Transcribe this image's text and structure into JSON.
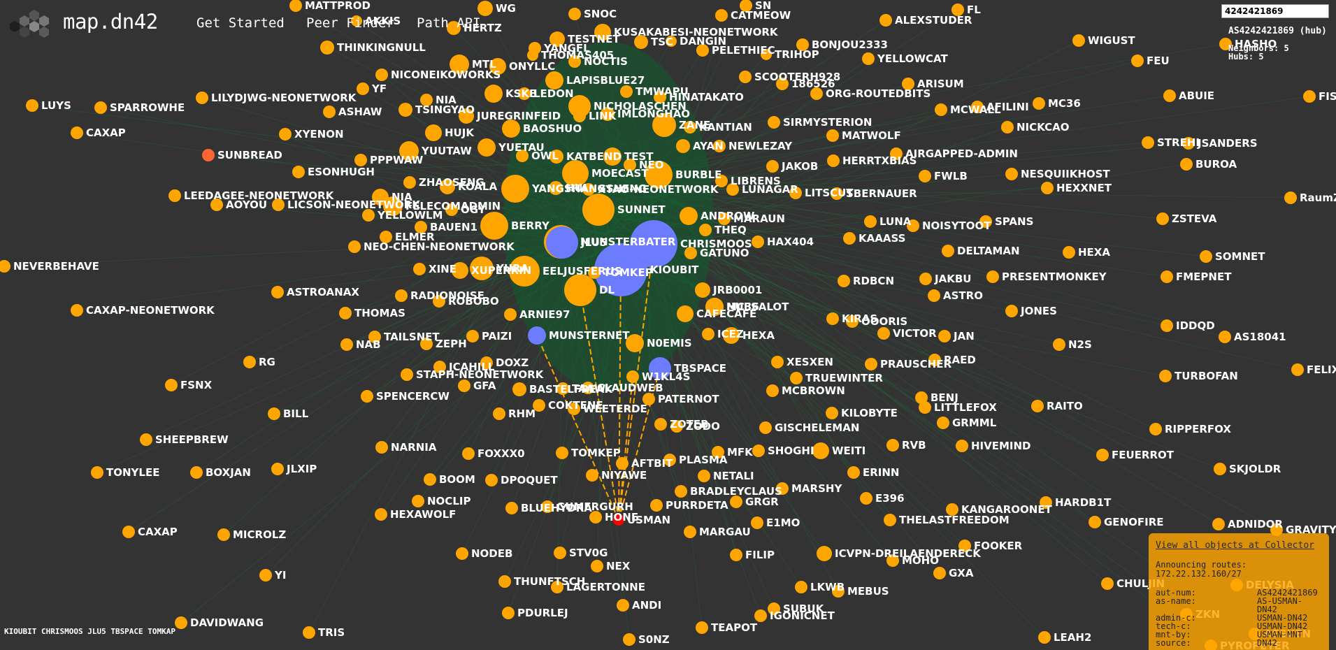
{
  "header": {
    "brand": "map.dn42",
    "nav": [
      "Get Started",
      "Peer Finder",
      "Path API"
    ]
  },
  "search": {
    "value": "4242421869"
  },
  "info": {
    "title": "AS4242421869 (hub)",
    "neighbors": "Neighbors: 5",
    "hubs": "Hubs: 5"
  },
  "collector": {
    "link": "View all objects at Collector",
    "routes_heading": "Announcing routes:",
    "route": "172.22.132.160/27",
    "fields": [
      [
        "aut-num:",
        "AS4242421869"
      ],
      [
        "as-name:",
        "AS-USMAN-DN42"
      ],
      [
        "admin-c:",
        "USMAN-DN42"
      ],
      [
        "tech-c:",
        "USMAN-DN42"
      ],
      [
        "mnt-by:",
        "USMAN-MNT"
      ],
      [
        "source:",
        "DN42"
      ]
    ]
  },
  "footer": {
    "hubs": "KIOUBIT CHRISMOOS JLU5 TBSPACE TOMKAP"
  },
  "colors": {
    "background": "#333333",
    "node": "#ffa500",
    "hub": "#6d7bff",
    "selected": "#ff0000",
    "sunbread": "#ff6432",
    "edge": "#1f7a3c",
    "highlight_edge": "#ffa500"
  },
  "graph": {
    "selected": "USMAN",
    "hubs": [
      "KIOUBIT",
      "CHRISMOOS",
      "JLU5",
      "TBSPACE",
      "MUNSTERNET"
    ],
    "nodes": [
      "MATTPROD",
      "WG",
      "AKKIS",
      "HERTZ",
      "SNOC",
      "SN",
      "CATMEOW",
      "ALEXSTUDER",
      "FL",
      "TESTNET",
      "KUSAKABESI-NEONETWORK",
      "YANGFL",
      "THOMAS405",
      "TSC",
      "DANGIN",
      "PELETHIEC",
      "TRIHOP",
      "BONJOU2333",
      "WIGUST",
      "HASHO",
      "THINKINGNULL",
      "MTL",
      "ONYLLC",
      "NOCTIS",
      "YELLOWCAT",
      "FEU",
      "NICONEIKOWORKS",
      "LAPISBLUE27",
      "SCOOTERH928",
      "186526",
      "ARISUM",
      "LUYS",
      "SPARROWHE",
      "LILYDJWG-NEONETWORK",
      "YF",
      "KSKB",
      "LEDON",
      "TMWAPU",
      "HINATAKATO",
      "ORG-ROUTEDBITS",
      "ABUIE",
      "FIS",
      "ASHAW",
      "NIA",
      "TSINGYAO",
      "JUREGRINFEID",
      "NICHOLASCHEN",
      "LINK",
      "IMLONGHAO",
      "MCWALL",
      "AFILINI",
      "MC36",
      "ZANE",
      "KANTIAN",
      "SIRMYSTERION",
      "NICKCAO",
      "XYENON",
      "HUJK",
      "BAOSHUO",
      "MATWOLF",
      "SUNBREAD",
      "YUUTAW",
      "YUETAU",
      "OWL",
      "KATBEND",
      "TEST",
      "NEO",
      "AYAN",
      "NEWLEZAY",
      "STREHI",
      "JSANDERS",
      "PPPWAW",
      "JAKOB",
      "HERRTXBIAS",
      "AIRGAPPED-ADMIN",
      "BUROA",
      "ESONHUGH",
      "MOECAST",
      "BURBLE",
      "FWLB",
      "NESQUIIKHOST",
      "ZHAOSENG",
      "KOALA",
      "YANGSHANGSHENG",
      "HUI",
      "XTAO-NEONETWORK",
      "LIBRENS",
      "LUNAGAR",
      "LITSCUT",
      "SBERNAUER",
      "HEXXNET",
      "LEEDAGEE-NEONETWORK",
      "AOYOU",
      "LICSON-NEONETWORK",
      "NIA",
      "FELECOMADMIN",
      "OGY",
      "RaumZ",
      "YELLOWLM",
      "SUNNET",
      "ANDROW",
      "MARAUN",
      "LUNA",
      "NOISYTOOT",
      "SPANS",
      "ZSTEVA",
      "BAUEN1",
      "BERRY",
      "THEQ",
      "KAAASS",
      "ELMER",
      "MUNSTERBATER",
      "JLU5",
      "HAX404",
      "DELTAMAN",
      "HEXA",
      "SOMNET",
      "NEO-CHEN-NEONETWORK",
      "CHRISMOOS",
      "GATUNO",
      "NEVERBEHAVE",
      "XINE",
      "XUPERRIN",
      "EELJUSFERUS",
      "KIOUBIT",
      "FMEPNET",
      "PRESENTMONKEY",
      "JAKBU",
      "RDBCN",
      "YURA",
      "JRB0001",
      "ASTROANAX",
      "RADIONOISE",
      "MC36",
      "DL",
      "ASTRO",
      "ROBOBO",
      "HUESALOT",
      "JONES",
      "CAXAP-NEONETWORK",
      "THOMAS",
      "ARNIE97",
      "CAFECAFE",
      "KIRAS",
      "OOORIS",
      "IDDQD",
      "VICTOR",
      "TAILSNET",
      "PAIZI",
      "ICEZ",
      "HEXA",
      "JAN",
      "AS18041",
      "MUNSTERNET",
      "ZEPH",
      "NAB",
      "N0EMIS",
      "N2S",
      "XESXEN",
      "PRAUSCHER",
      "RAED",
      "RG",
      "JCAHILL",
      "DOXZ",
      "TBSPACE",
      "FELIX",
      "STAPH-NEONETWORK",
      "W1KL4S",
      "TRUEWINTER",
      "TURBOFAN",
      "FSNX",
      "GFA",
      "BASTELFREAK",
      "TAAW",
      "CLAUDWEB",
      "MCBROWN",
      "CAXAP",
      "SPENCERCW",
      "BENJ",
      "PATERNOT",
      "COKTENE",
      "WEETERDE",
      "KILOBYTE",
      "LITTLEFOX",
      "RAITO",
      "BILL",
      "RHM",
      "ZOTEB",
      "ZODO",
      "GRMML",
      "GISCHELEMAN",
      "RIPPERFOX",
      "SHEEPBREW",
      "NARNIA",
      "FOXXX0",
      "TOMKEP",
      "MFK",
      "SHOGHI",
      "WEITI",
      "RVB",
      "HIVEMIND",
      "FEUERROT",
      "AFTBIT",
      "PLASMA",
      "TONYLEE",
      "BOXJAN",
      "JLXIP",
      "BOOM",
      "DPOQUET",
      "NIYAWE",
      "NETALI",
      "ERINN",
      "SKJOLDR",
      "BRADLEYCLAUS",
      "MARSHY",
      "NOCLIP",
      "GRGR",
      "E396",
      "KANGAROONET",
      "HARDB1T",
      "HEXAWOLF",
      "BLUEHYDRA",
      "GUMERGURH",
      "HONE",
      "PURRDETA",
      "E1MO",
      "THELASTFREEDOM",
      "GENOFIRE",
      "ADNIDOR",
      "GRAVITY",
      "CAXAP",
      "MICROLZ",
      "MARGAU",
      "NODEB",
      "STV0G",
      "FILIP",
      "ICVPN-DREILAENDERECK",
      "MOHO",
      "FOOKER",
      "NEX",
      "YI",
      "GXA",
      "THUNFTSCH",
      "LAGERTONNE",
      "LKWB",
      "MEBUS",
      "CHULJIN",
      "DELYSIA",
      "PDURLEJ",
      "ANDI",
      "TOMKEP",
      "SUBUK",
      "IGONICNET",
      "DAVIDWANG",
      "TEAPOT",
      "TRIS",
      "S0NZ",
      "LEAH2",
      "PYROPETER",
      "ZKN",
      "AESXEN"
    ]
  }
}
